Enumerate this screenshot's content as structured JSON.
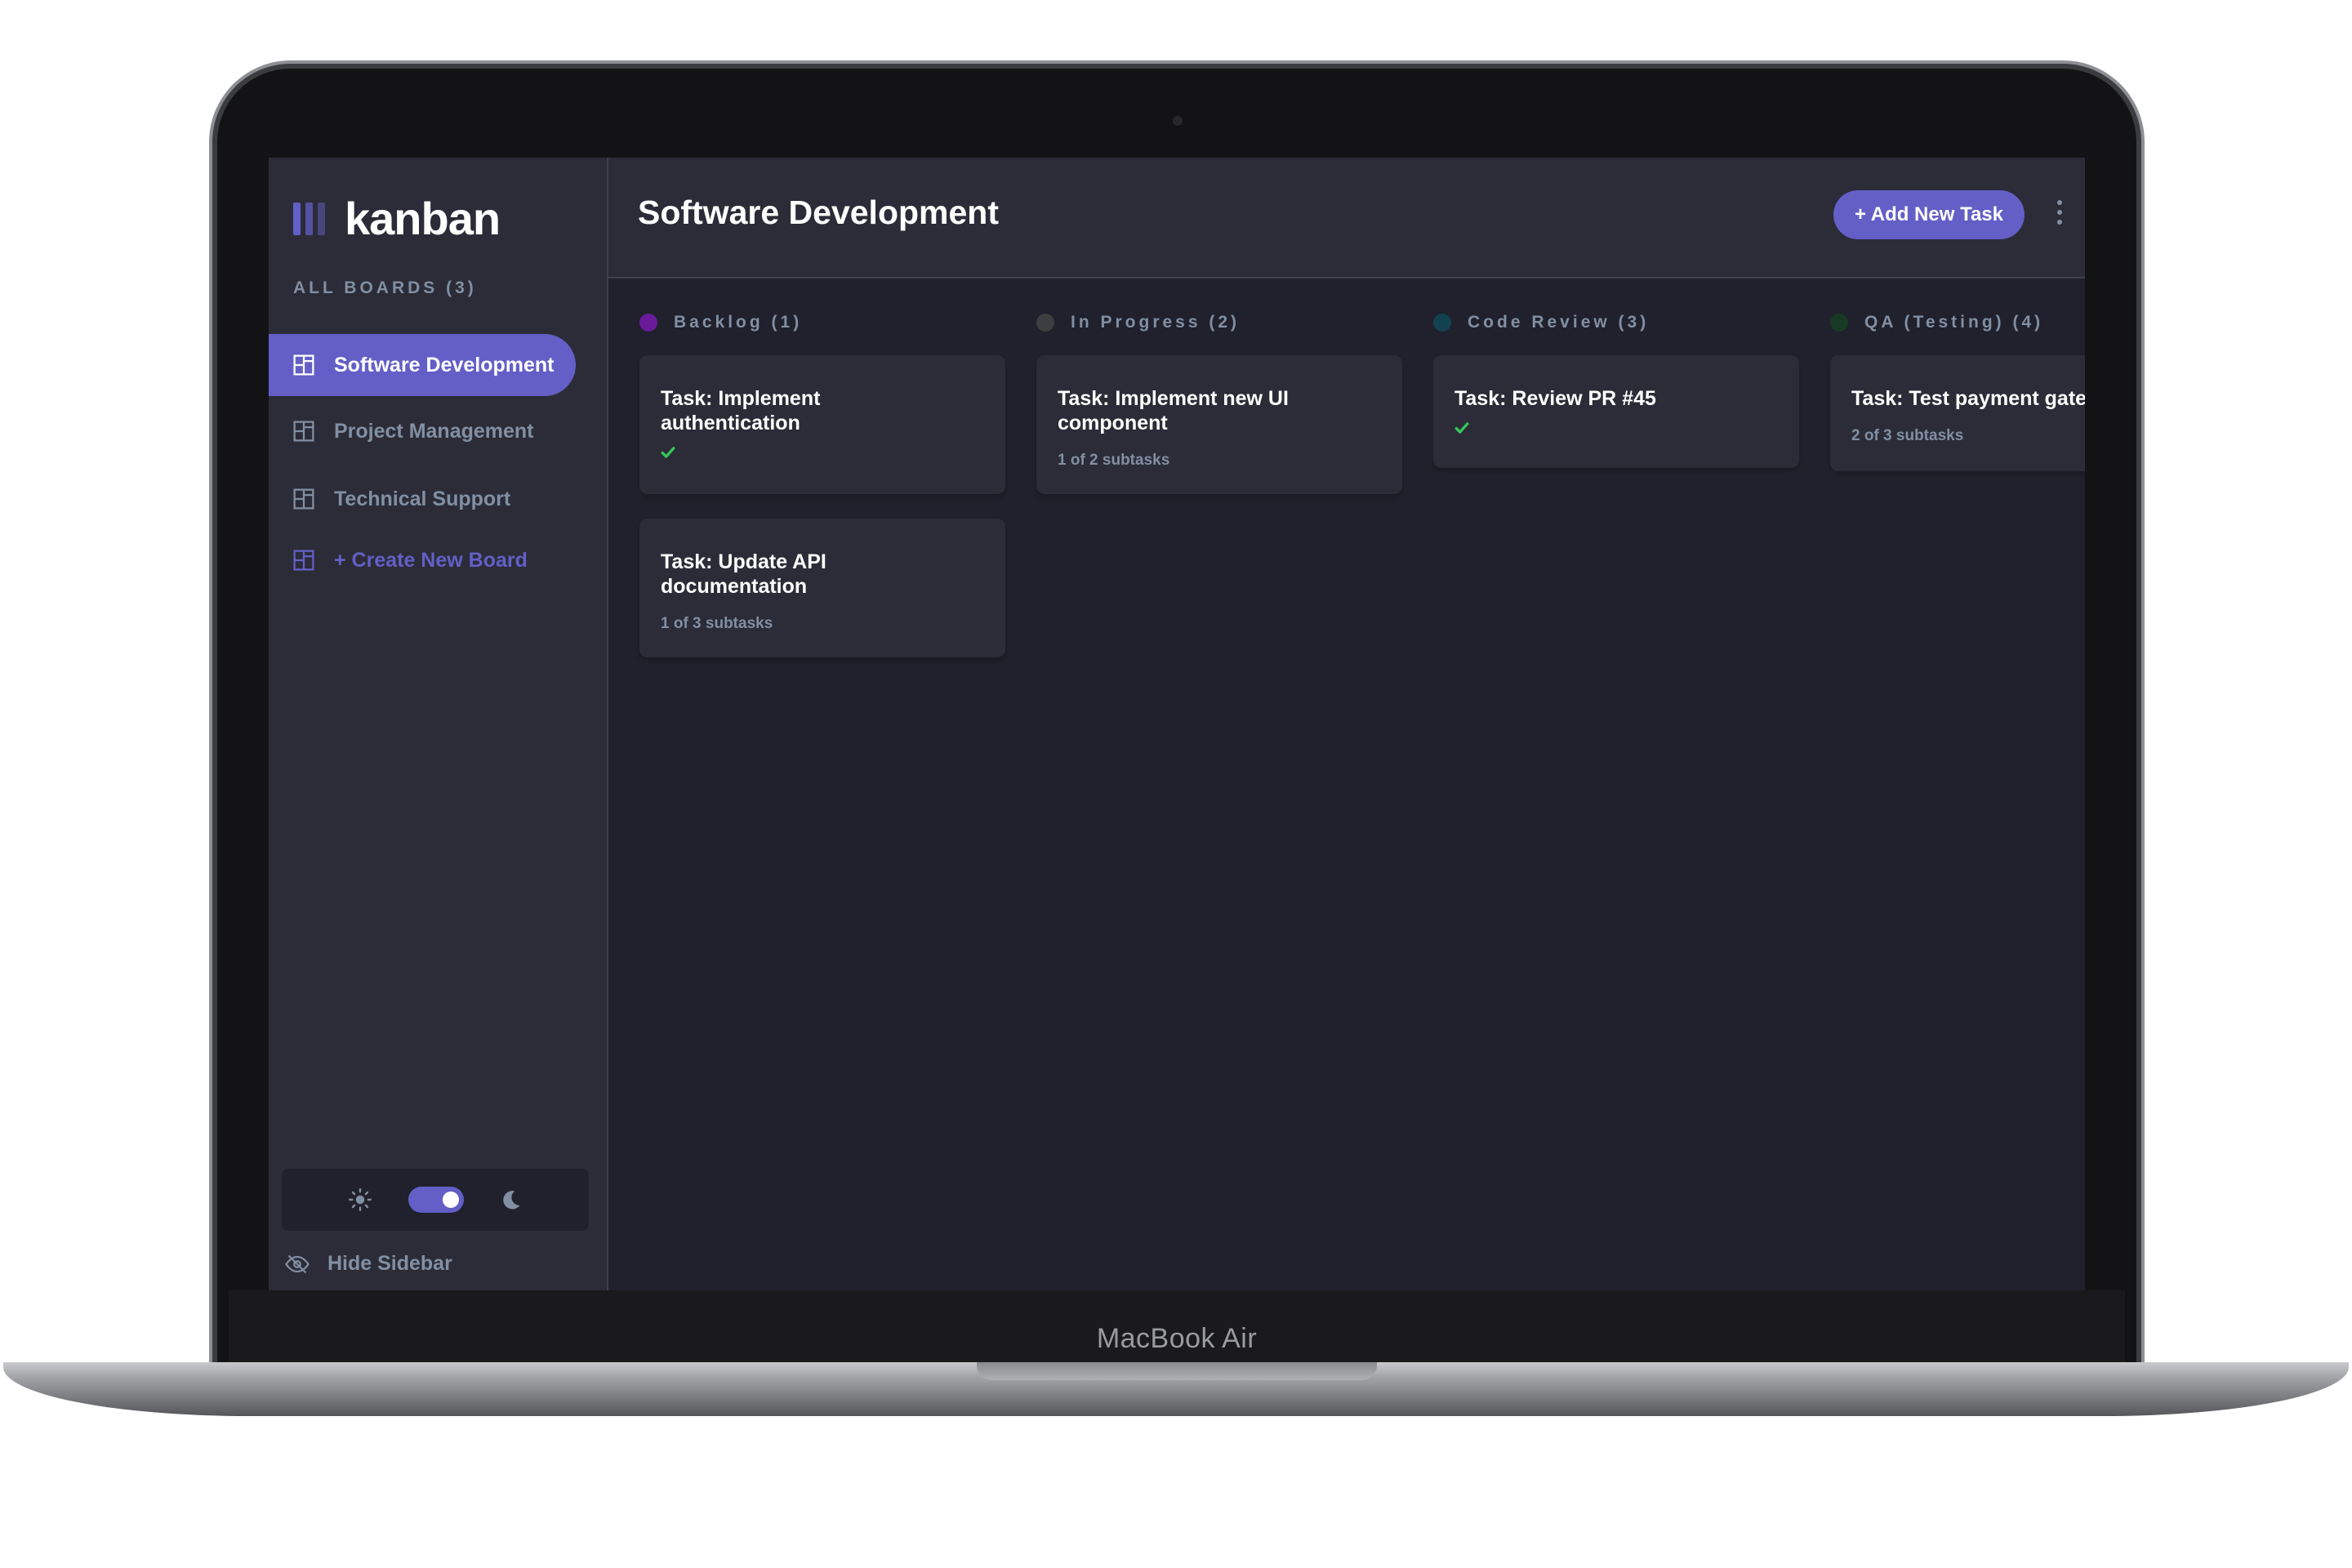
{
  "device": {
    "label": "MacBook Air"
  },
  "app": {
    "logo_text": "kanban"
  },
  "sidebar": {
    "all_boards_label": "ALL BOARDS (3)",
    "boards": [
      {
        "label": "Software Development",
        "active": true
      },
      {
        "label": "Project Management",
        "active": false
      },
      {
        "label": "Technical Support",
        "active": false
      }
    ],
    "create_label": "+ Create New Board",
    "theme": {
      "mode": "dark",
      "light_icon": "sun-icon",
      "dark_icon": "moon-icon"
    },
    "hide_label": "Hide Sidebar"
  },
  "header": {
    "title": "Software Development",
    "add_task_label": "+ Add New Task",
    "menu_icon": "vertical-ellipsis-icon"
  },
  "columns": [
    {
      "title": "Backlog (1)",
      "color": "#6a1b9a",
      "cards": [
        {
          "title": "Task: Implement\nauthentication",
          "subtitle": "",
          "done": true
        },
        {
          "title": "Task: Update API\ndocumentation",
          "subtitle": "1 of 3 subtasks",
          "done": false
        }
      ]
    },
    {
      "title": "In Progress (2)",
      "color": "#3c3f3f",
      "cards": [
        {
          "title": "Task: Implement new UI\ncomponent",
          "subtitle": "1 of 2 subtasks",
          "done": false
        }
      ]
    },
    {
      "title": "Code Review (3)",
      "color": "#12424f",
      "cards": [
        {
          "title": "Task: Review PR #45",
          "subtitle": "",
          "done": true
        }
      ]
    },
    {
      "title": "QA (Testing) (4)",
      "color": "#173a24",
      "cards": [
        {
          "title": "Task: Test payment gatew",
          "subtitle": "2 of 3 subtasks",
          "done": false
        }
      ]
    }
  ],
  "colors": {
    "accent": "#635fc7",
    "check": "#34c759"
  }
}
